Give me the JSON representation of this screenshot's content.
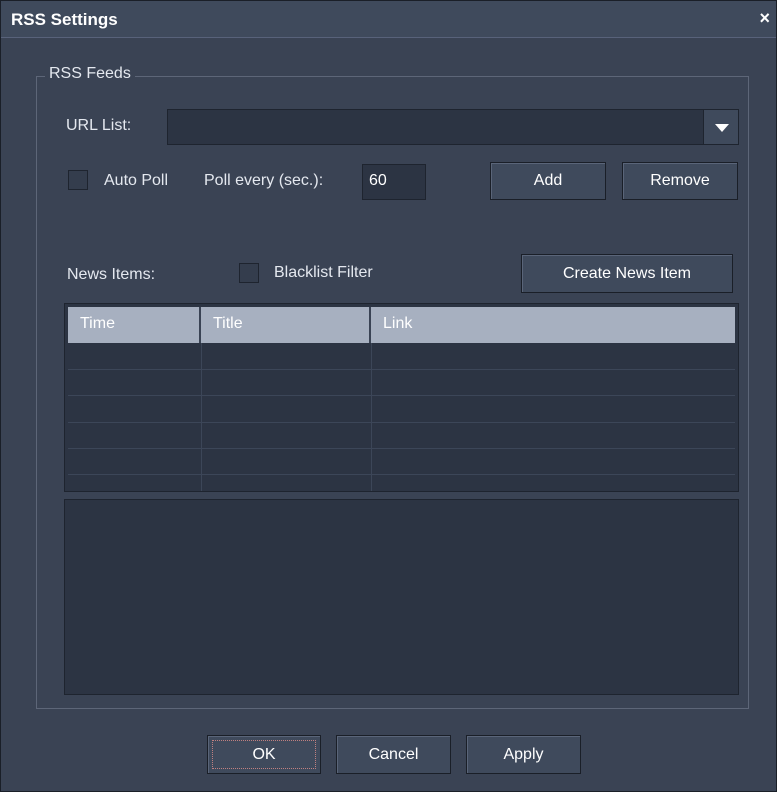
{
  "window": {
    "title": "RSS Settings",
    "close_glyph": "×"
  },
  "rss_feeds": {
    "group_label": "RSS Feeds",
    "url_list": {
      "label": "URL List:",
      "value": ""
    },
    "auto_poll": {
      "label": "Auto Poll",
      "checked": false
    },
    "poll_every": {
      "label": "Poll every (sec.):",
      "value": "60"
    },
    "add_label": "Add",
    "remove_label": "Remove",
    "news_items_label": "News Items:",
    "blacklist_filter": {
      "label": "Blacklist Filter",
      "checked": false
    },
    "create_news_item_label": "Create News Item",
    "table": {
      "columns": [
        "Time",
        "Title",
        "Link"
      ],
      "rows": []
    }
  },
  "footer": {
    "ok_label": "OK",
    "cancel_label": "Cancel",
    "apply_label": "Apply"
  }
}
